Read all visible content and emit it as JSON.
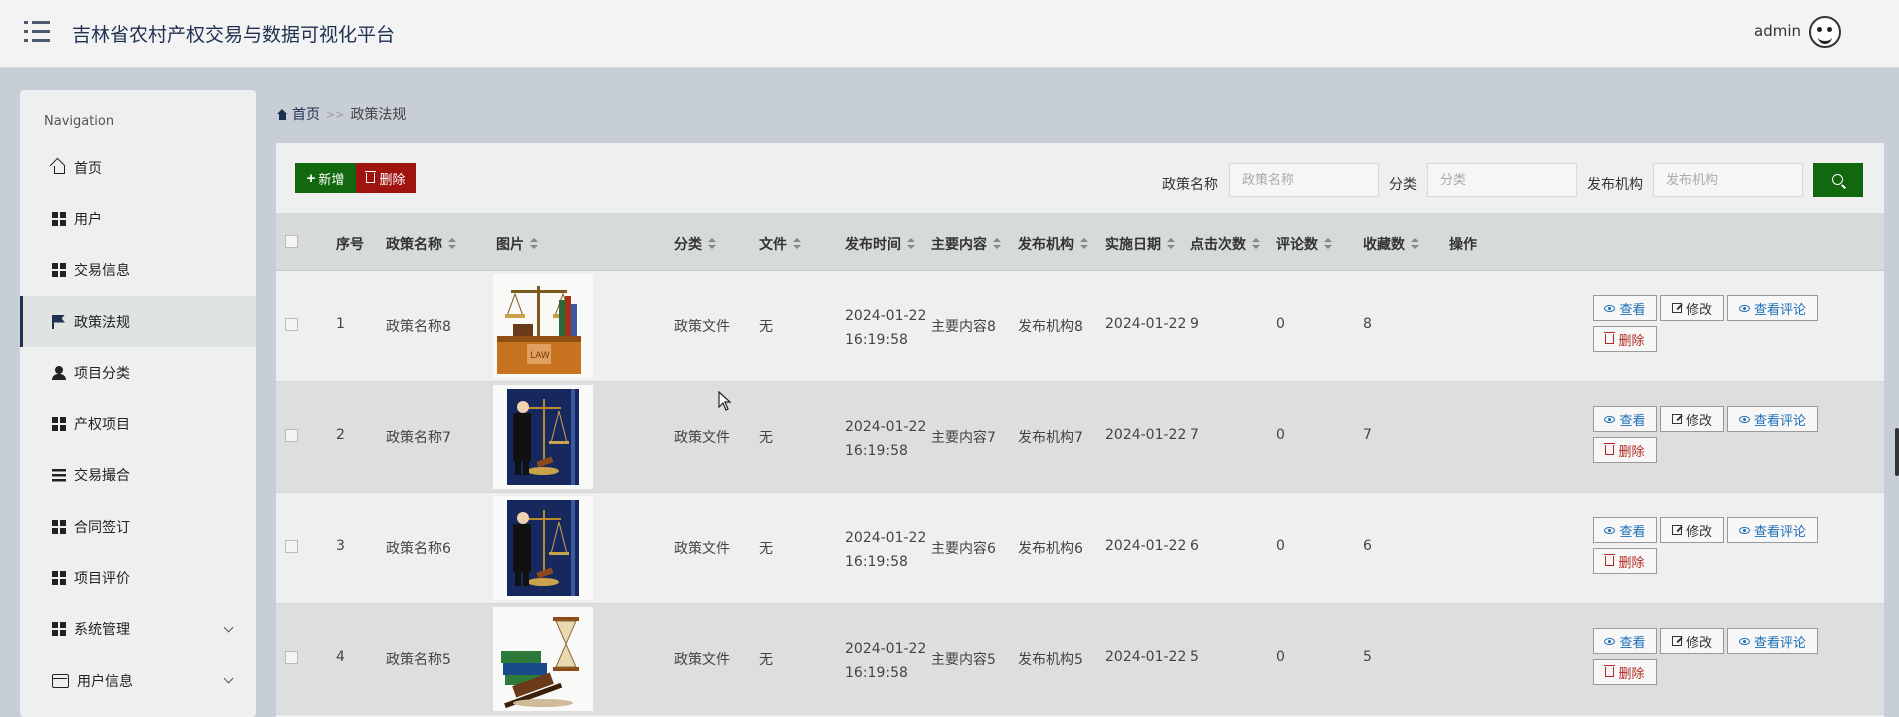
{
  "header": {
    "app_title": "吉林省农村产权交易与数据可视化平台",
    "user_name": "admin",
    "menu_icon": "menu-icon",
    "avatar_icon": "avatar-icon"
  },
  "sidebar": {
    "heading": "Navigation",
    "items": [
      {
        "label": "首页",
        "icon": "home-icon",
        "active": false,
        "expandable": false
      },
      {
        "label": "用户",
        "icon": "grid-icon",
        "active": false,
        "expandable": false
      },
      {
        "label": "交易信息",
        "icon": "grid-icon",
        "active": false,
        "expandable": false
      },
      {
        "label": "政策法规",
        "icon": "flag-icon",
        "active": true,
        "expandable": false
      },
      {
        "label": "项目分类",
        "icon": "user-icon",
        "active": false,
        "expandable": false
      },
      {
        "label": "产权项目",
        "icon": "grid-icon",
        "active": false,
        "expandable": false
      },
      {
        "label": "交易撮合",
        "icon": "list-icon",
        "active": false,
        "expandable": false
      },
      {
        "label": "合同签订",
        "icon": "grid-icon",
        "active": false,
        "expandable": false
      },
      {
        "label": "项目评价",
        "icon": "grid-icon",
        "active": false,
        "expandable": false
      },
      {
        "label": "系统管理",
        "icon": "grid-icon",
        "active": false,
        "expandable": true
      },
      {
        "label": "用户信息",
        "icon": "card-icon",
        "active": false,
        "expandable": true
      }
    ]
  },
  "breadcrumb": {
    "home": "首页",
    "separator": ">>",
    "current": "政策法规"
  },
  "toolbar": {
    "add_label": "新增",
    "delete_label": "删除",
    "search_fields": [
      {
        "label": "政策名称",
        "placeholder": "政策名称"
      },
      {
        "label": "分类",
        "placeholder": "分类"
      },
      {
        "label": "发布机构",
        "placeholder": "发布机构"
      }
    ],
    "search_icon": "search-icon"
  },
  "table": {
    "columns": [
      {
        "label": "序号",
        "sortable": false
      },
      {
        "label": "政策名称",
        "sortable": true
      },
      {
        "label": "图片",
        "sortable": true
      },
      {
        "label": "分类",
        "sortable": true
      },
      {
        "label": "文件",
        "sortable": true
      },
      {
        "label": "发布时间",
        "sortable": true
      },
      {
        "label": "主要内容",
        "sortable": true
      },
      {
        "label": "发布机构",
        "sortable": true
      },
      {
        "label": "实施日期",
        "sortable": true
      },
      {
        "label": "点击次数",
        "sortable": true
      },
      {
        "label": "评论数",
        "sortable": true
      },
      {
        "label": "收藏数",
        "sortable": true
      },
      {
        "label": "操作",
        "sortable": false
      }
    ],
    "rows": [
      {
        "index": "1",
        "name": "政策名称8",
        "image": "scales-law-book-image",
        "category": "政策文件",
        "file": "无",
        "publish_date": "2024-01-22",
        "publish_time": "16:19:58",
        "content": "主要内容8",
        "agency": "发布机构8",
        "effective_date": "2024-01-22",
        "clicks": "9",
        "comments": "0",
        "favorites": "8"
      },
      {
        "index": "2",
        "name": "政策名称7",
        "image": "lawyer-scales-image",
        "category": "政策文件",
        "file": "无",
        "publish_date": "2024-01-22",
        "publish_time": "16:19:58",
        "content": "主要内容7",
        "agency": "发布机构7",
        "effective_date": "2024-01-22",
        "clicks": "7",
        "comments": "0",
        "favorites": "7"
      },
      {
        "index": "3",
        "name": "政策名称6",
        "image": "lawyer-scales-image",
        "category": "政策文件",
        "file": "无",
        "publish_date": "2024-01-22",
        "publish_time": "16:19:58",
        "content": "主要内容6",
        "agency": "发布机构6",
        "effective_date": "2024-01-22",
        "clicks": "6",
        "comments": "0",
        "favorites": "6"
      },
      {
        "index": "4",
        "name": "政策名称5",
        "image": "gavel-hourglass-image",
        "category": "政策文件",
        "file": "无",
        "publish_date": "2024-01-22",
        "publish_time": "16:19:58",
        "content": "主要内容5",
        "agency": "发布机构5",
        "effective_date": "2024-01-22",
        "clicks": "5",
        "comments": "0",
        "favorites": "5"
      }
    ],
    "actions": {
      "view": "查看",
      "edit": "修改",
      "view_comments": "查看评论",
      "delete": "删除"
    }
  },
  "colors": {
    "primary_green": "#11680e",
    "danger_red": "#a0140f",
    "nav_active": "#1e3150",
    "link_blue": "#1c6eb8"
  }
}
